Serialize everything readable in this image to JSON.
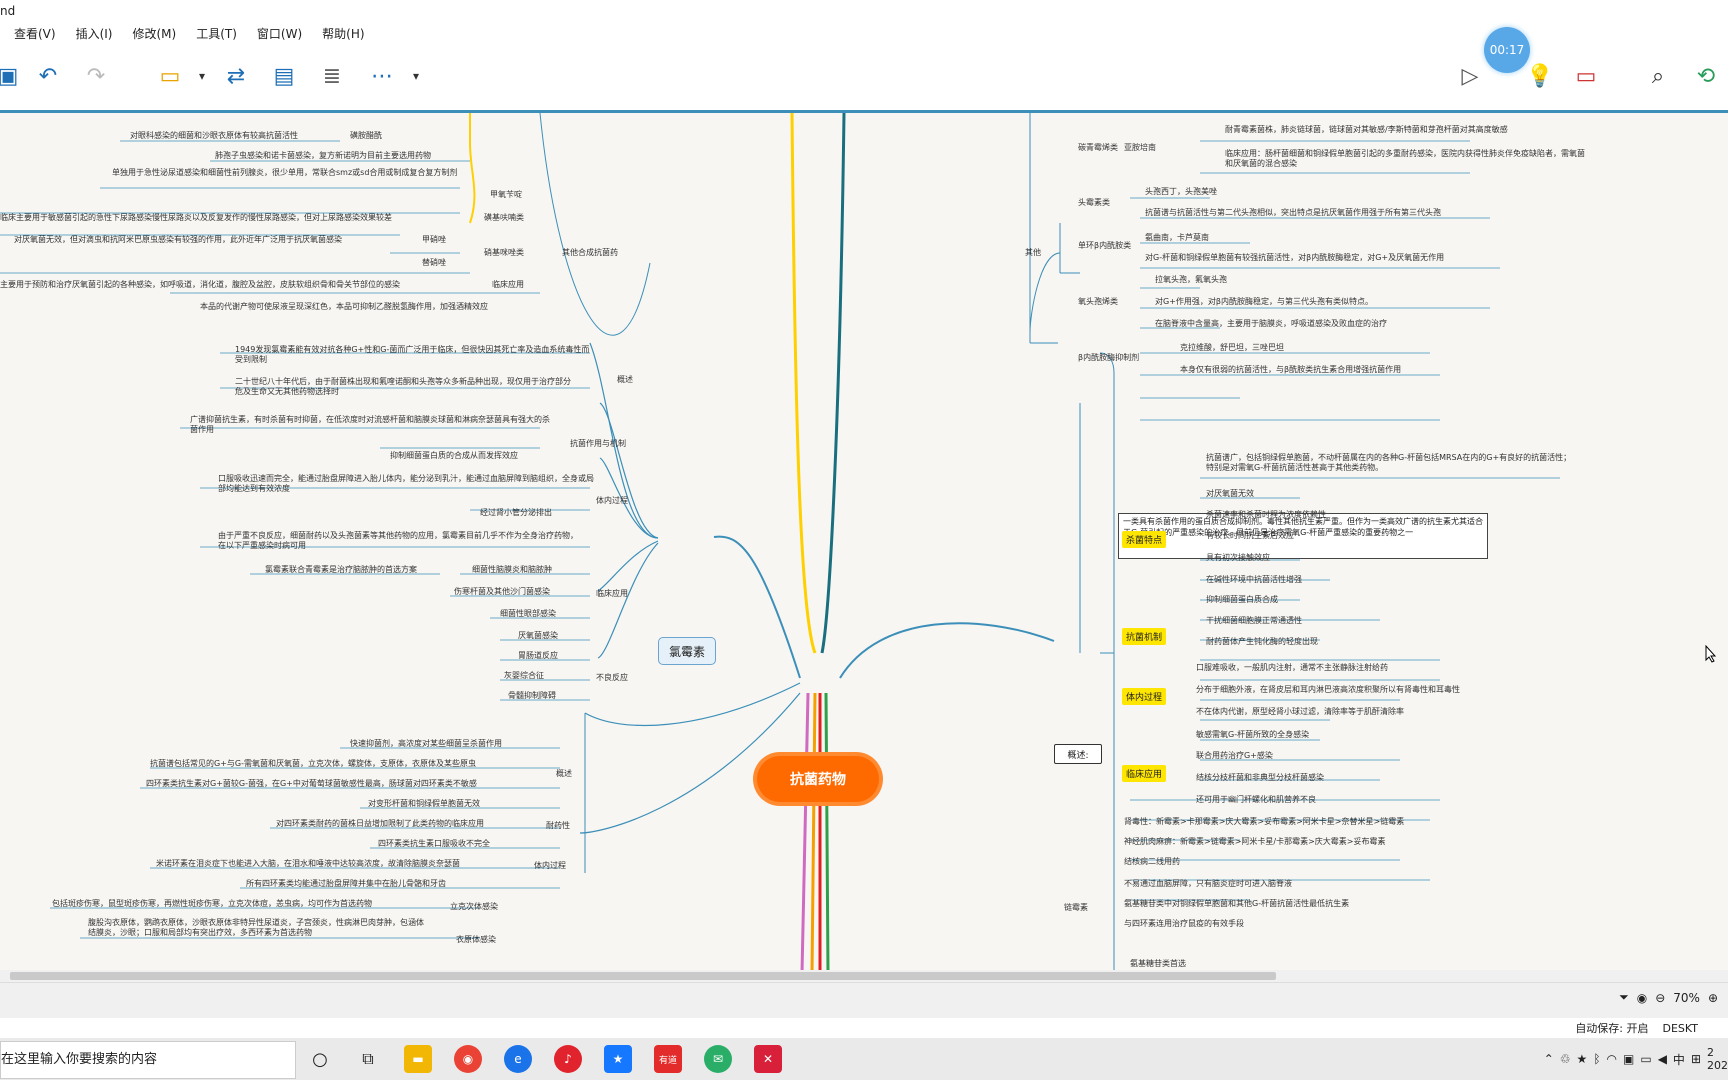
{
  "window": {
    "title_fragment": "nd"
  },
  "menu": [
    "查看(V)",
    "插入(I)",
    "修改(M)",
    "工具(T)",
    "窗口(W)",
    "帮助(H)"
  ],
  "menu_first": "查看(V)",
  "timer": "00:17",
  "mindmap": {
    "root": "抗菌药物",
    "left_branch": "氯霉素",
    "right_branch": "概述:",
    "boxed_note": "一类具有杀菌作用的蛋白质合成抑制剂。毒性其他抗生素严重。但作为一类高效广谱的抗生素尤其适合于G-菌引起的严重感染的治疗。目前仍是治疗需氧G-杆菌严重感染的重要药物之一",
    "left_nodes": [
      "对眼科感染的细菌和沙眼衣原体有较高抗菌活性",
      "磺胺醋酰",
      "肺孢子虫感染和诺卡菌感染，复方新诺明为目前主要选用药物",
      "单独用于急性泌尿道感染和细菌性前列腺炎，很少单用，常联合smz或sd合用或制成复合复方制剂",
      "甲氧苄啶",
      "临床主要用于敏感菌引起的急性下尿路感染慢性尿路炎以及反复发作的慢性尿路感染，但对上尿路感染效果较差",
      "磺基呋喃类",
      "对厌氧菌无效，但对滴虫和抗阿米巴原虫感染有较强的作用，此外近年广泛用于抗厌氧菌感染",
      "甲硝唑",
      "替硝唑",
      "硝基咪唑类",
      "其他合成抗菌药",
      "临床应用",
      "主要用于预防和治疗厌氧菌引起的各种感染，如呼吸道，消化道，腹腔及盆腔，皮肤软组织骨和骨关节部位的感染",
      "本品的代谢产物可使尿液呈现深红色，本品可抑制乙醛脱氢酶作用，加强酒精效应",
      "1949发现氯霉素能有效对抗各种G+性和G-菌而广泛用于临床，但很快因其死亡率及造血系统毒性而受到限制",
      "二十世纪八十年代后，由于耐菌株出现和氟喹诺酮和头孢等众多新品种出现，现仅用于治疗部分危及生命又无其他药物选择时",
      "概述",
      "广谱抑菌抗生素，有时杀菌有时抑菌，在低浓度时对流感杆菌和脑膜炎球菌和淋病奈瑟菌具有强大的杀菌作用",
      "抗菌作用与机制",
      "抑制细菌蛋白质的合成从而发挥效应",
      "口服吸收迅速而完全，能通过胎盘屏障进入胎儿体内，能分泌到乳汁，能通过血脑屏障到脑组织，全身或局部均能达到有效浓度",
      "体内过程",
      "经过肾小管分泌排出",
      "由于严重不良反应，细菌耐药以及头孢菌素等其他药物的应用，氯霉素目前几乎不作为全身治疗药物，在以下严重感染时病可用",
      "氯霉素联合青霉素是治疗脑脓肿的首选方案",
      "细菌性脑膜炎和脑脓肿",
      "伤寒杆菌及其他沙门菌感染",
      "临床应用",
      "细菌性眼部感染",
      "厌氧菌感染",
      "胃肠道反应",
      "灰婴综合征",
      "骨髓抑制障碍",
      "不良反应",
      "快速抑菌剂，高浓度对某些细菌呈杀菌作用",
      "抗菌谱包括常见的G+与G-需氧菌和厌氧菌，立克次体，螺旋体，支原体，衣原体及某些原虫",
      "四环素类抗生素对G+菌较G-菌强，在G+中对葡萄球菌敏感性最高，肠球菌对四环素类不敏感",
      "对变形杆菌和铜绿假单胞菌无效",
      "概述",
      "对四环素类耐药的菌株日益增加限制了此类药物的临床应用",
      "耐药性",
      "四环素类抗生素口服吸收不完全",
      "米诺环素在泪炎症下也能进入大脑，在泪水和唾液中达较高浓度，故清除脑膜炎奈瑟菌",
      "所有四环素类均能通过胎盘屏障并集中在胎儿骨骼和牙齿",
      "体内过程",
      "包括斑疹伤寒，鼠型斑疹伤寒，再燃性斑疹伤寒，立克次体痘，恙虫病，均可作为首选药物",
      "立克次体感染",
      "腹股沟衣原体，鹦鹉衣原体，沙眼衣原体非特异性尿道炎，子宫颈炎，性病淋巴肉芽肿，包涵体结膜炎，沙眼；口服和局部均有突出疗效，多西环素为首选药物",
      "衣原体感染"
    ],
    "right_nodes": [
      "耐青霉素菌株，肺炎链球菌，链球菌对其敏感/李斯特菌和芽孢杆菌对其高度敏感",
      "亚胺培南",
      "碳青霉烯类",
      "临床应用：肠杆菌细菌和铜绿假单胞菌引起的多重耐药感染，医院内获得性肺炎伴免疫缺陷者，需氧菌和厌氧菌的混合感染",
      "头孢西丁，头孢美唑",
      "头霉素类",
      "抗菌谱与抗菌活性与第二代头孢相似，突出特点是抗厌氧菌作用强于所有第三代头孢",
      "其他",
      "氨曲南，卡芦莫南",
      "单环β内酰胺类",
      "对G-杆菌和铜绿假单胞菌有较强抗菌活性，对β内酰胺酶稳定，对G+及厌氧菌无作用",
      "拉氧头孢，氟氧头孢",
      "氧头孢烯类",
      "对G+作用强，对β内酰胺酶稳定，与第三代头孢有类似特点。",
      "在脑脊液中含量高，主要用于脑膜炎，呼吸道感染及败血症的治疗",
      "克拉维酸，舒巴坦，三唑巴坦",
      "β内酰胺酶抑制剂",
      "本身仅有很弱的抗菌活性，与β酰胺类抗生素合用增强抗菌作用",
      "抗菌谱广，包括铜绿假单胞菌，不动杆菌属在内的各种G-杆菌包括MRSA在内的G+有良好的抗菌活性；特别是对需氧G-杆菌抗菌活性甚高于其他类药物。",
      "杀菌特点",
      "对厌氧菌无效",
      "杀菌速率和杀菌时程为浓度依赖性",
      "有较长时间抗生素后效应",
      "具有初次接触效应",
      "在碱性环境中抗菌活性增强",
      "抑制细菌蛋白质合成",
      "抗菌机制",
      "干扰细菌细胞膜正常通透性",
      "耐药菌体产生钝化酶的轻度出现",
      "口服难吸收，一般肌内注射，通常不主张静脉注射给药",
      "体内过程",
      "分布于细胞外液，在肾皮层和耳内淋巴液高浓度积聚所以有肾毒性和耳毒性",
      "不在体内代谢，原型经肾小球过滤，清除率等于肌酐清除率",
      "敏感需氧G-杆菌所致的全身感染",
      "联合用药治疗G+感染",
      "临床应用",
      "结核分枝杆菌和非典型分枝杆菌感染",
      "还可用于幽门杆螺化和肌营养不良",
      "肾毒性：新霉素>卡那霉素>庆大霉素>妥布霉素>阿米卡星>奈替米星>链霉素",
      "神经肌肉麻痹：新霉素>链霉素>阿米卡星/卡那霉素>庆大霉素>妥布霉素",
      "结核病二线用药",
      "链霉素",
      "不易通过血脑屏障，只有脑炎症时可进入脑脊液",
      "氨基糖苷类中对铜绿假单胞菌和其他G-杆菌抗菌活性最低抗生素",
      "与四环素连用治疗鼠疫的有效手段",
      "氨基糖苷类首选"
    ]
  },
  "zoom": "70%",
  "status": {
    "autosave": "自动保存: 开启",
    "desktop": "DESKT"
  },
  "taskbar": {
    "search_placeholder": "在这里输入你要搜索的内容",
    "clock_time": "2",
    "clock_date": "202",
    "ime": "中"
  },
  "colors": {
    "root": "#ff6a00",
    "accent": "#3c8fb8",
    "highlight": "#ffe600"
  }
}
